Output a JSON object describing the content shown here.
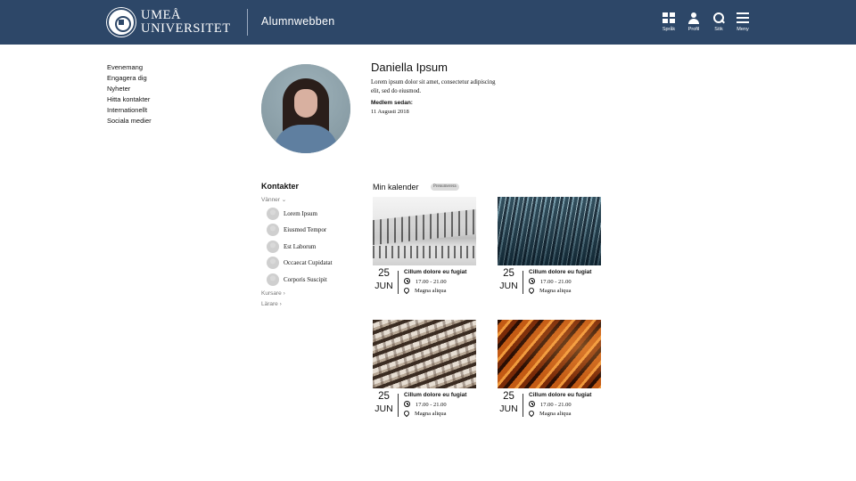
{
  "header": {
    "brand_line1": "UMEÅ",
    "brand_line2": "UNIVERSITET",
    "app_name": "Alumnwebben",
    "actions": [
      {
        "label": "Språk",
        "icon": "language-grid-icon"
      },
      {
        "label": "Profil",
        "icon": "profile-icon"
      },
      {
        "label": "Sök",
        "icon": "search-icon"
      },
      {
        "label": "Meny",
        "icon": "menu-icon"
      }
    ],
    "bar_color": "#2d4768"
  },
  "nav": {
    "items": [
      "Evenemang",
      "Engagera dig",
      "Nyheter",
      "Hitta kontakter",
      "Internationellt",
      "Sociala medier"
    ]
  },
  "profile": {
    "name": "Daniella Ipsum",
    "description": "Lorem ipsum dolor sit amet, consectetur adipiscing elit, sed do eiusmod.",
    "member_since_label": "Medlem sedan:",
    "member_since_value": "11 Augusti 2018"
  },
  "contacts": {
    "title": "Kontakter",
    "friends_label": "Vänner",
    "friends": [
      "Lorem Ipsum",
      "Eiusmod Tempor",
      "Est Laborum",
      "Occaecat Cupidatat",
      "Corporis Suscipit"
    ],
    "courses_label": "Kursare",
    "teachers_label": "Lärare"
  },
  "calendar": {
    "title": "Min kalender",
    "badge": "Prenumerera",
    "events": [
      {
        "day": "25",
        "month": "JUN",
        "title": "Cillum dolore eu fugiat",
        "time": "17.00 - 21.00",
        "place": "Magna aliqua"
      },
      {
        "day": "25",
        "month": "JUN",
        "title": "Cillum dolore eu fugiat",
        "time": "17.00 - 21.00",
        "place": "Magna aliqua"
      },
      {
        "day": "25",
        "month": "JUN",
        "title": "Cillum dolore eu fugiat",
        "time": "17.00 - 21.00",
        "place": "Magna aliqua"
      },
      {
        "day": "25",
        "month": "JUN",
        "title": "Cillum dolore eu fugiat",
        "time": "17.00 - 21.00",
        "place": "Magna aliqua"
      }
    ]
  }
}
